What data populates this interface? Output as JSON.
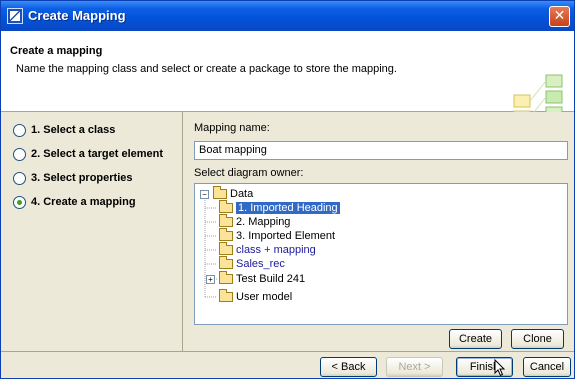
{
  "window": {
    "title": "Create Mapping",
    "close_glyph": "✕"
  },
  "header": {
    "title": "Create a mapping",
    "description": "Name the mapping class and select or create a package to store the mapping."
  },
  "steps": [
    {
      "label": "1. Select a class",
      "selected": false
    },
    {
      "label": "2. Select a target element",
      "selected": false
    },
    {
      "label": "3. Select properties",
      "selected": false
    },
    {
      "label": "4. Create a mapping",
      "selected": true
    }
  ],
  "form": {
    "name_label": "Mapping name:",
    "name_value": "Boat mapping",
    "owner_label": "Select diagram owner:"
  },
  "tree": {
    "root": {
      "label": "Data",
      "expander": "−"
    },
    "children": [
      {
        "label": "1. Imported Heading",
        "selected": true
      },
      {
        "label": "2. Mapping"
      },
      {
        "label": "3. Imported Element"
      },
      {
        "label": "class + mapping",
        "colored": true
      },
      {
        "label": "Sales_rec",
        "colored": true
      },
      {
        "label": "Test Build 241",
        "expander": "+"
      },
      {
        "label": "User model"
      }
    ]
  },
  "buttons": {
    "create": "Create",
    "clone": "Clone",
    "back": "< Back",
    "next": "Next >",
    "finish": "Finish",
    "cancel": "Cancel"
  },
  "colors": {
    "titlebar": "#0352d7",
    "selection": "#316ac5",
    "radio_selected": "#3aa12b"
  }
}
